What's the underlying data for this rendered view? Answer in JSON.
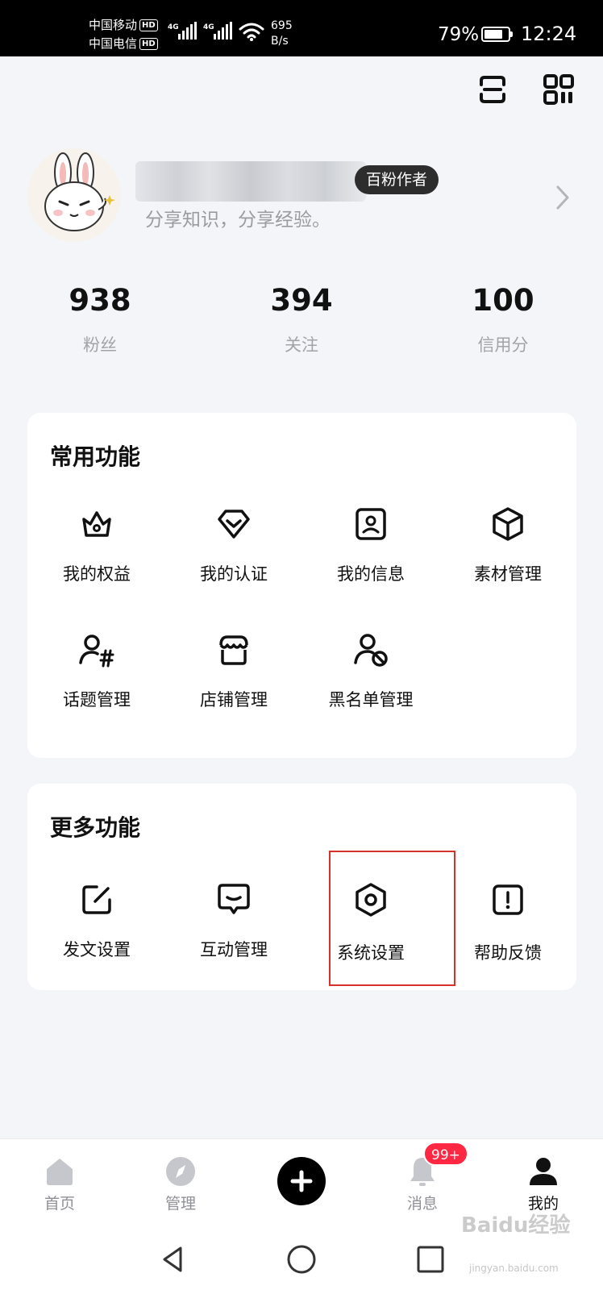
{
  "status_bar": {
    "carrier1": "中国移动",
    "carrier2": "中国电信",
    "hd": "HD",
    "network": "4G",
    "speed_value": "695",
    "speed_unit": "B/s",
    "battery_pct": "79%",
    "battery_level": 0.79,
    "time": "12:24"
  },
  "top_actions": {
    "scan_icon": "scan-icon",
    "qr_icon": "qr-code-icon"
  },
  "profile": {
    "badge": "百粉作者",
    "bio": "分享知识，分享经验。"
  },
  "stats": [
    {
      "value": "938",
      "label": "粉丝"
    },
    {
      "value": "394",
      "label": "关注"
    },
    {
      "value": "100",
      "label": "信用分"
    }
  ],
  "common_functions": {
    "title": "常用功能",
    "items": [
      {
        "label": "我的权益",
        "icon": "crown-icon"
      },
      {
        "label": "我的认证",
        "icon": "verified-badge-icon"
      },
      {
        "label": "我的信息",
        "icon": "id-card-icon"
      },
      {
        "label": "素材管理",
        "icon": "cube-icon"
      },
      {
        "label": "话题管理",
        "icon": "topic-hashtag-icon"
      },
      {
        "label": "店铺管理",
        "icon": "store-icon"
      },
      {
        "label": "黑名单管理",
        "icon": "blacklist-user-icon"
      }
    ]
  },
  "more_functions": {
    "title": "更多功能",
    "items": [
      {
        "label": "发文设置",
        "icon": "edit-icon"
      },
      {
        "label": "互动管理",
        "icon": "chat-bubble-icon"
      },
      {
        "label": "系统设置",
        "icon": "hexagon-settings-icon"
      },
      {
        "label": "帮助反馈",
        "icon": "alert-feedback-icon"
      }
    ]
  },
  "bottom_nav": {
    "items": [
      {
        "label": "首页",
        "icon": "home-icon"
      },
      {
        "label": "管理",
        "icon": "compass-icon"
      },
      {
        "label": "消息",
        "icon": "bell-icon"
      },
      {
        "label": "我的",
        "icon": "person-icon"
      }
    ],
    "publish_icon": "plus-icon",
    "message_badge": "99+",
    "active": "我的"
  },
  "watermark": {
    "main": "Baidu经验",
    "sub": "jingyan.baidu.com"
  },
  "colors": {
    "background": "#f4f5f9",
    "card": "#ffffff",
    "badge_bg": "#2d2d2d",
    "highlight_border": "#d8302b",
    "notification_badge": "#ff2742",
    "muted_text": "#9a9ba0"
  }
}
